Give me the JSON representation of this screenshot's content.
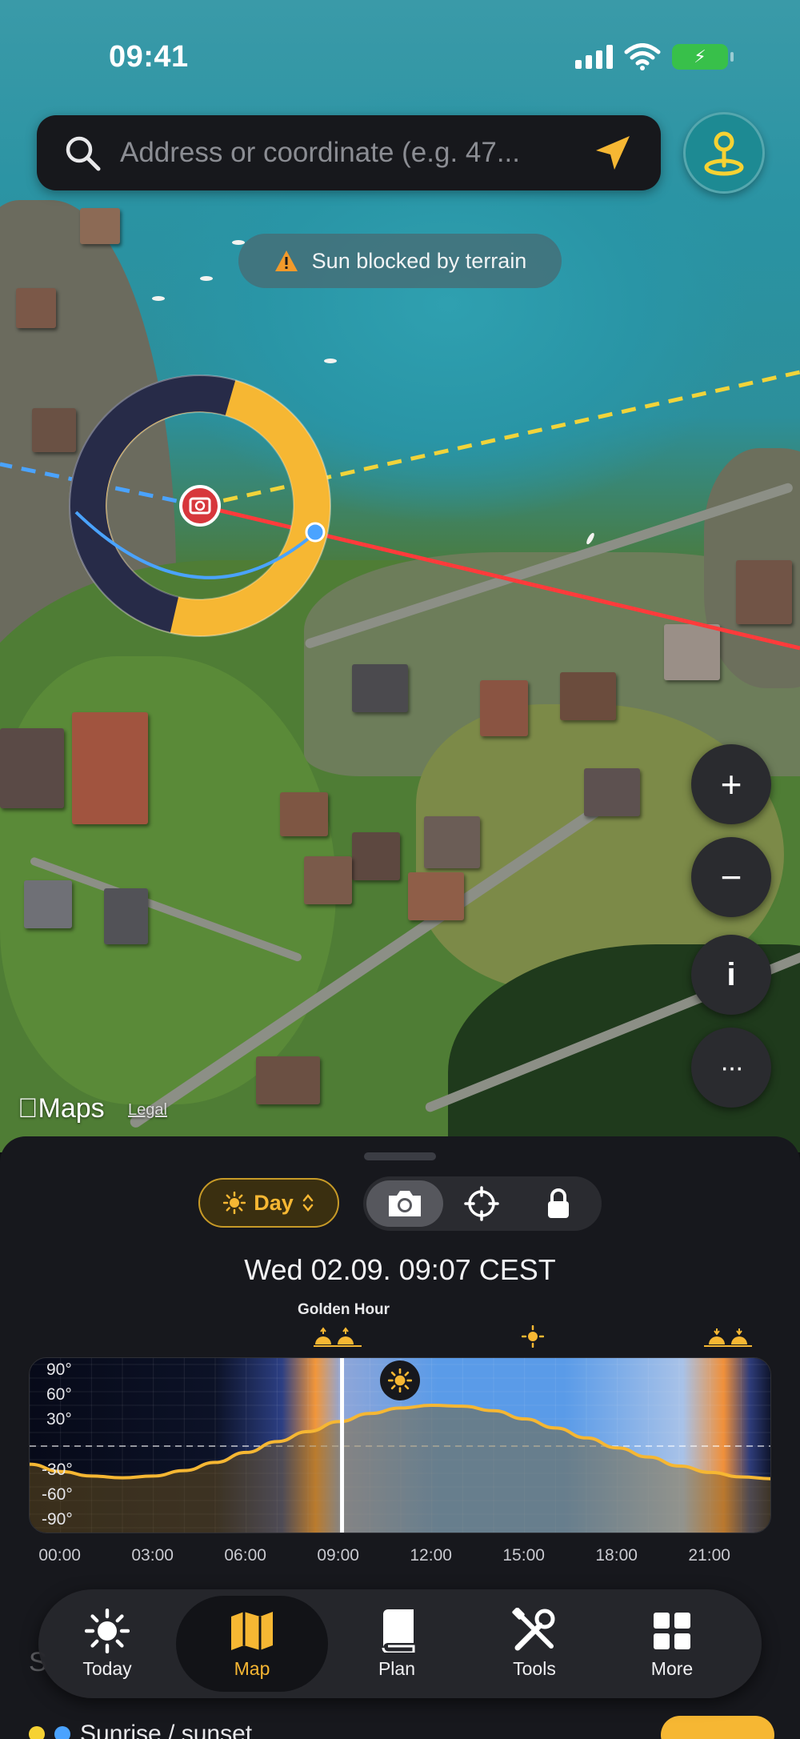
{
  "status_bar": {
    "time": "09:41"
  },
  "search": {
    "placeholder": "Address or coordinate (e.g. 47..."
  },
  "toast": {
    "text": "Sun blocked by terrain"
  },
  "map_controls": {
    "zoom_in": "+",
    "zoom_out": "−",
    "info": "i",
    "more": "···"
  },
  "map_attribution": {
    "logo": "Maps",
    "legal": "Legal"
  },
  "sheet": {
    "mode": {
      "label": "Day"
    },
    "datetime": "Wed 02.09. 09:07  CEST",
    "golden_hour_label": "Golden Hour",
    "obscured_title": "S",
    "obscured_row": "Sunrise / sunset"
  },
  "chart_data": {
    "type": "line",
    "x_labels": [
      "00:00",
      "03:00",
      "06:00",
      "09:00",
      "12:00",
      "15:00",
      "18:00",
      "21:00"
    ],
    "y_labels": [
      "90°",
      "60°",
      "30°",
      "-30°",
      "-60°",
      "-90°"
    ],
    "x_range_hours": [
      -1,
      23
    ],
    "now_hour": 9.1,
    "series": [
      {
        "hours": [
          -1,
          0,
          1,
          2,
          3,
          4,
          5,
          6,
          7,
          8,
          9,
          10,
          11,
          12,
          13,
          14,
          15,
          16,
          17,
          18,
          19,
          20,
          21,
          22,
          23
        ],
        "altitude_deg": [
          -20,
          -28,
          -33,
          -35,
          -33,
          -27,
          -18,
          -7,
          5,
          16,
          27,
          36,
          42,
          45,
          44,
          39,
          30,
          20,
          9,
          -2,
          -12,
          -22,
          -29,
          -34,
          -36
        ]
      }
    ],
    "colors": {
      "sun_path": "#f6b733",
      "day": "#5a9be8",
      "night": "#0c1024",
      "golden": "#f2a33a",
      "now_line": "#ffffff"
    }
  },
  "tabs": [
    {
      "label": "Today",
      "icon": "sun-icon"
    },
    {
      "label": "Map",
      "icon": "map-icon"
    },
    {
      "label": "Plan",
      "icon": "book-icon"
    },
    {
      "label": "Tools",
      "icon": "tools-icon"
    },
    {
      "label": "More",
      "icon": "grid-icon"
    }
  ]
}
